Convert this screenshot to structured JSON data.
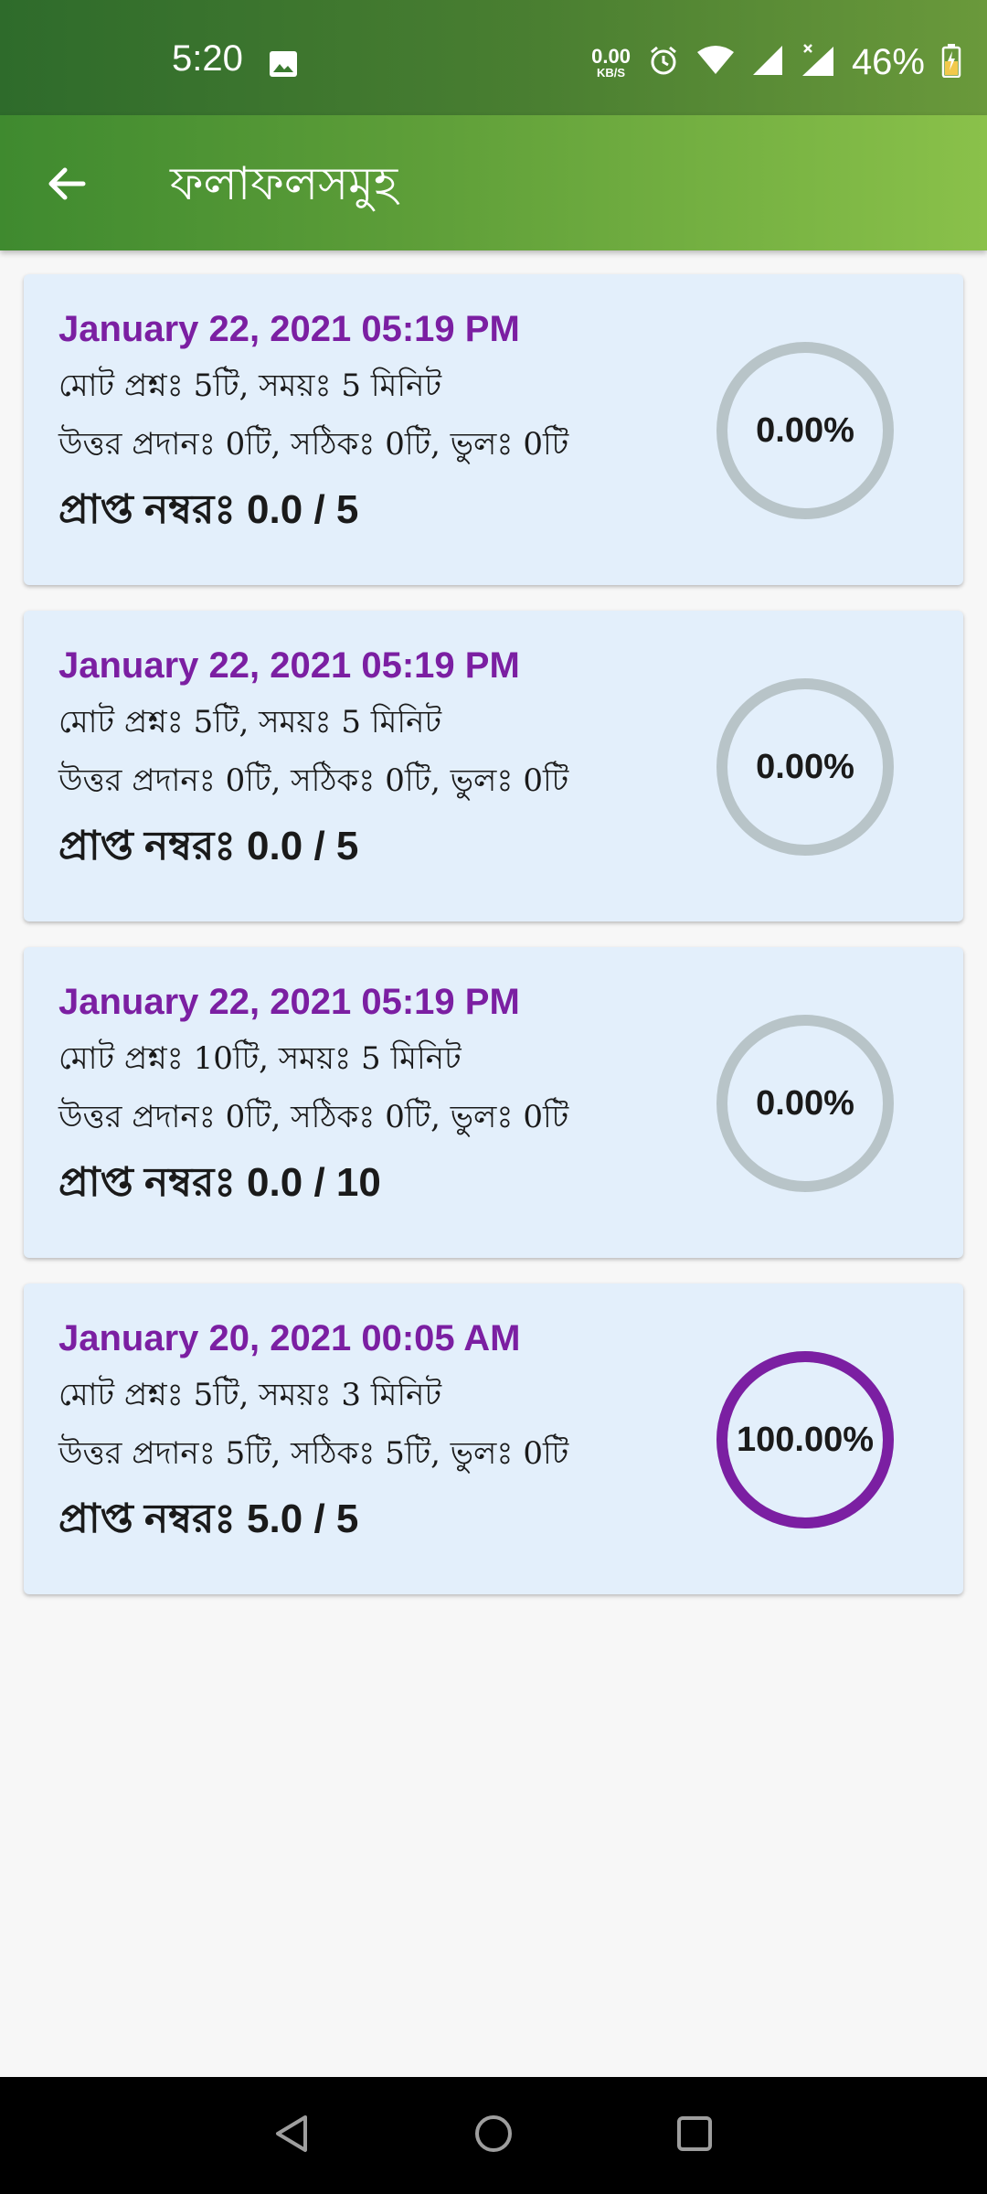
{
  "status_bar": {
    "time": "5:20",
    "net_speed_value": "0.00",
    "net_speed_unit": "KB/S",
    "battery_percent": "46%",
    "icons": [
      "image-icon",
      "alarm-icon",
      "wifi-icon",
      "signal-icon",
      "signal-no-data-icon",
      "battery-charging-icon"
    ]
  },
  "app_bar": {
    "title": "ফলাফলসমুহ",
    "back_icon": "arrow-back-icon"
  },
  "colors": {
    "accent_purple": "#7b1fa2",
    "ring_empty": "#b8c4c8",
    "card_bg": "#e3effb"
  },
  "results": [
    {
      "date": "January 22, 2021 05:19 PM",
      "line1": "মোট প্রশ্নঃ 5টি, সময়ঃ 5 মিনিট",
      "line2": "উত্তর প্রদানঃ 0টি, সঠিকঃ 0টি, ভুলঃ 0টি",
      "score": "প্রাপ্ত নম্বরঃ 0.0 / 5",
      "percent_text": "0.00%",
      "percent": 0
    },
    {
      "date": "January 22, 2021 05:19 PM",
      "line1": "মোট প্রশ্নঃ 5টি, সময়ঃ 5 মিনিট",
      "line2": "উত্তর প্রদানঃ 0টি, সঠিকঃ 0টি, ভুলঃ 0টি",
      "score": "প্রাপ্ত নম্বরঃ 0.0 / 5",
      "percent_text": "0.00%",
      "percent": 0
    },
    {
      "date": "January 22, 2021 05:19 PM",
      "line1": "মোট প্রশ্নঃ 10টি, সময়ঃ 5 মিনিট",
      "line2": "উত্তর প্রদানঃ 0টি, সঠিকঃ 0টি, ভুলঃ 0টি",
      "score": "প্রাপ্ত নম্বরঃ 0.0 / 10",
      "percent_text": "0.00%",
      "percent": 0
    },
    {
      "date": "January 20, 2021 00:05 AM",
      "line1": "মোট প্রশ্নঃ 5টি, সময়ঃ 3 মিনিট",
      "line2": "উত্তর প্রদানঃ 5টি, সঠিকঃ 5টি, ভুলঃ 0টি",
      "score": "প্রাপ্ত নম্বরঃ 5.0 / 5",
      "percent_text": "100.00%",
      "percent": 100
    }
  ],
  "nav_bar": {
    "icons": [
      "nav-back-icon",
      "nav-home-icon",
      "nav-recents-icon"
    ]
  }
}
